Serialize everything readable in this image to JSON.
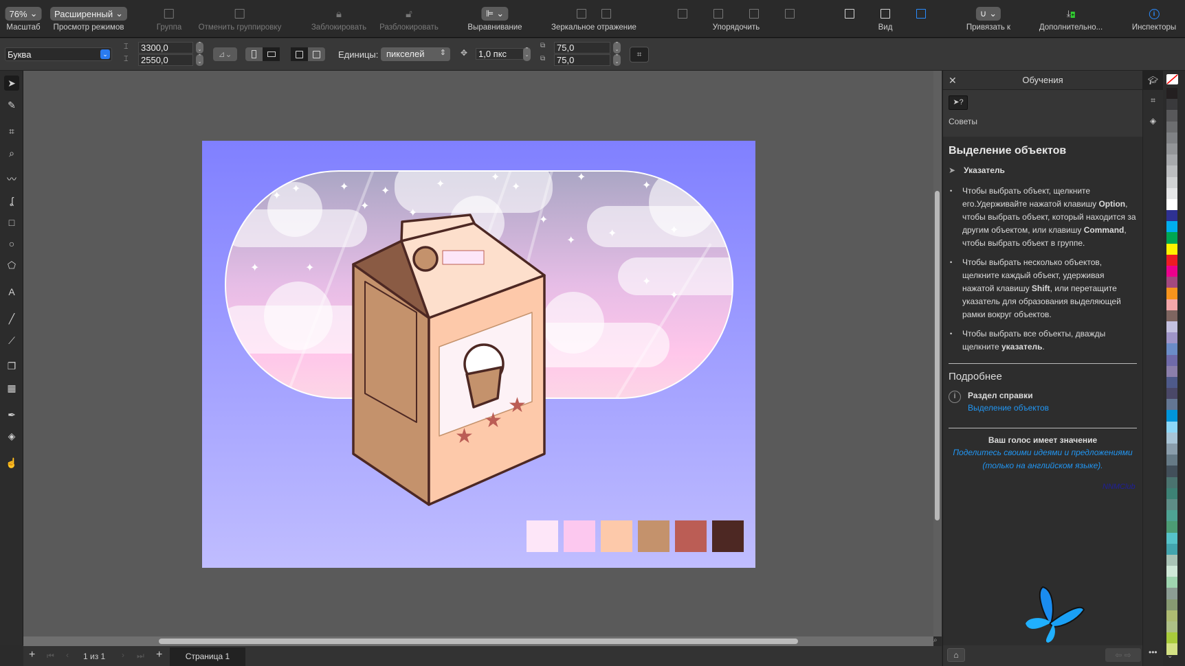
{
  "toolbar": {
    "zoom": {
      "value": "76%",
      "label": "Масштаб"
    },
    "view_modes": {
      "value": "Расширенный",
      "label": "Просмотр режимов"
    },
    "group": "Группа",
    "ungroup": "Отменить группировку",
    "lock": "Заблокировать",
    "unlock": "Разблокировать",
    "align": "Выравнивание",
    "mirror": "Зеркальное отражение",
    "arrange": "Упорядочить",
    "view": "Вид",
    "snap": "Привязать к",
    "more": "Дополнительно...",
    "inspectors": "Инспекторы"
  },
  "propbar": {
    "preset": "Буква",
    "width": "3300,0",
    "height": "2550,0",
    "units_label": "Единицы:",
    "units": "пикселей",
    "nudge": "1,0 пкс",
    "dup_x": "75,0",
    "dup_y": "75,0"
  },
  "bottombar": {
    "page_count": "1 из 1",
    "page_tab": "Страница 1"
  },
  "panel": {
    "title": "Обучения",
    "tips_label": "Советы",
    "heading": "Выделение объектов",
    "tool_name": "Указатель",
    "bullets": [
      {
        "parts": [
          "Чтобы выбрать объект, щелкните его.Удерживайте нажатой клавишу ",
          "Option",
          ", чтобы выбрать объект, который находится за другим объектом, или клавишу ",
          "Command",
          ", чтобы выбрать объект в группе."
        ]
      },
      {
        "parts": [
          "Чтобы выбрать несколько объектов, щелкните каждый объект, удерживая нажатой клавишу ",
          "Shift",
          ", или перетащите указатель для образования выделяющей рамки вокруг объектов."
        ]
      },
      {
        "parts": [
          "Чтобы выбрать все объекты, дважды щелкните ",
          "указатель",
          "."
        ]
      }
    ],
    "more_heading": "Подробнее",
    "help_section": "Раздел справки",
    "help_link": "Выделение объектов",
    "feedback_title": "Ваш голос имеет значение",
    "feedback_link": "Поделитесь своими идеями и предложениями (только на английском языке).",
    "watermark": "NNMClub"
  },
  "artwork": {
    "swatches": [
      "#fde6f8",
      "#fcc8ef",
      "#fdc9aa",
      "#c4926c",
      "#bb5d55",
      "#4d2823"
    ]
  },
  "palette": [
    "#231f20",
    "#3a3a3c",
    "#58585a",
    "#6d6e70",
    "#808285",
    "#939598",
    "#a7a9ac",
    "#bcbec0",
    "#d1d3d4",
    "#e6e7e8",
    "#ffffff",
    "#2e3192",
    "#00aeef",
    "#00a651",
    "#fff200",
    "#ed1c24",
    "#ec008c",
    "#a3497f",
    "#f7941d",
    "#f4a7a9",
    "#7e6560",
    "#c4c1e0",
    "#9f95c8",
    "#6b8cc7",
    "#6f6aa9",
    "#8b7fab",
    "#4e5a8a",
    "#4a4868",
    "#637794",
    "#0095da",
    "#8dd7f7",
    "#a8c4d6",
    "#8a9dab",
    "#667a86",
    "#424f5a",
    "#4a736f",
    "#3d8275",
    "#5e8d87",
    "#4ea393",
    "#4c9c74",
    "#56c3c9",
    "#43a5ae",
    "#a9c3b6",
    "#cfe8d8",
    "#9fd5b0",
    "#8c9d94",
    "#879a72",
    "#aebb72",
    "#aec087",
    "#a9cb3b",
    "#d4e284"
  ],
  "colors": {
    "accent": "#2a8cff",
    "link": "#2196f3",
    "artboard_top": "#8080ff",
    "artboard_bottom": "#c0bdff"
  }
}
